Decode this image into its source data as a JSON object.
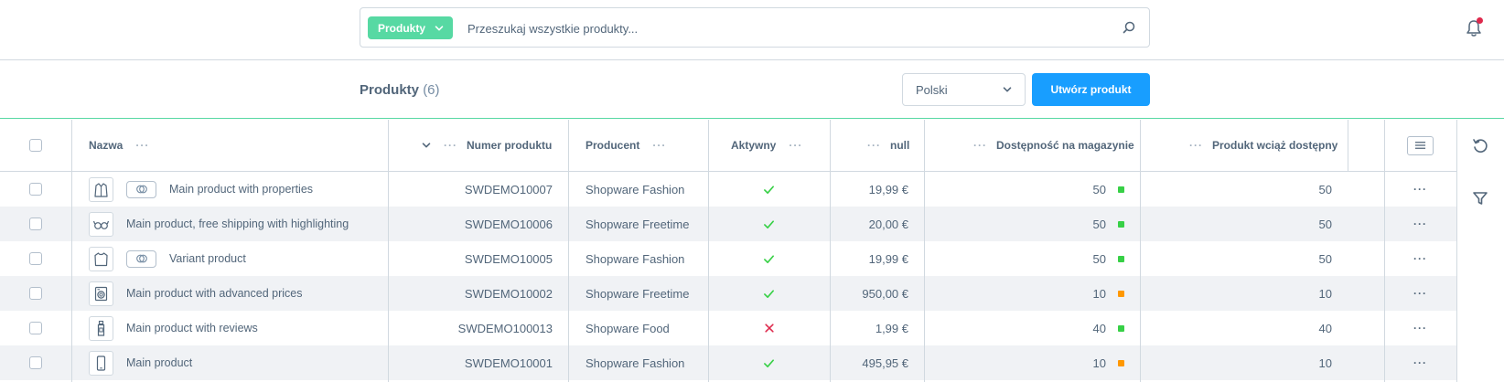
{
  "search": {
    "type_label": "Produkty",
    "placeholder": "Przeszukaj wszystkie produkty..."
  },
  "smartbar": {
    "title": "Produkty",
    "count": "(6)",
    "language": "Polski",
    "create_label": "Utwórz produkt"
  },
  "table": {
    "headers": {
      "name": "Nazwa",
      "product_number": "Numer produktu",
      "manufacturer": "Producent",
      "active": "Aktywny",
      "price": "null",
      "stock": "Dostępność na magazynie",
      "available": "Produkt wciąż dostępny"
    },
    "rows": [
      {
        "name": "Main product with properties",
        "number": "SWDEMO10007",
        "manufacturer": "Shopware Fashion",
        "active": true,
        "price": "19,99 €",
        "stock": "50",
        "stock_status": "green",
        "available": "50",
        "variant": true,
        "thumb": "jacket-icon"
      },
      {
        "name": "Main product, free shipping with highlighting",
        "number": "SWDEMO10006",
        "manufacturer": "Shopware Freetime",
        "active": true,
        "price": "20,00 €",
        "stock": "50",
        "stock_status": "green",
        "available": "50",
        "variant": false,
        "thumb": "sunglasses-icon"
      },
      {
        "name": "Variant product",
        "number": "SWDEMO10005",
        "manufacturer": "Shopware Fashion",
        "active": true,
        "price": "19,99 €",
        "stock": "50",
        "stock_status": "green",
        "available": "50",
        "variant": true,
        "thumb": "shirt-icon"
      },
      {
        "name": "Main product with advanced prices",
        "number": "SWDEMO10002",
        "manufacturer": "Shopware Freetime",
        "active": true,
        "price": "950,00 €",
        "stock": "10",
        "stock_status": "orange",
        "available": "10",
        "variant": false,
        "thumb": "washing-machine-icon"
      },
      {
        "name": "Main product with reviews",
        "number": "SWDEMO100013",
        "manufacturer": "Shopware Food",
        "active": false,
        "price": "1,99 €",
        "stock": "40",
        "stock_status": "green",
        "available": "40",
        "variant": false,
        "thumb": "bottle-icon"
      },
      {
        "name": "Main product",
        "number": "SWDEMO10001",
        "manufacturer": "Shopware Fashion",
        "active": true,
        "price": "495,95 €",
        "stock": "10",
        "stock_status": "orange",
        "available": "10",
        "variant": false,
        "thumb": "phone-icon"
      }
    ]
  },
  "colors": {
    "green": "#37d046",
    "orange": "#ff9800",
    "check": "#37d046",
    "cross": "#de294c",
    "primary": "#189eff",
    "accent": "#57d9a3"
  }
}
